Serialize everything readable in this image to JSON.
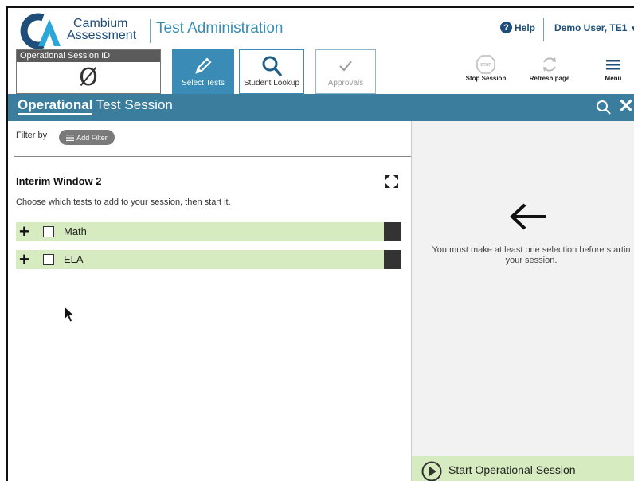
{
  "header": {
    "brand_line1": "Cambium",
    "brand_line2": "Assessment",
    "app_title": "Test Administration",
    "help_label": "Help",
    "user_label": "Demo User, TE1",
    "session_id_label": "Operational Session ID",
    "session_id_value": "Ø"
  },
  "tabs": [
    {
      "label": "Select Tests",
      "icon": "pencil-icon",
      "active": true
    },
    {
      "label": "Student Lookup",
      "icon": "search-icon",
      "active": false
    },
    {
      "label": "Approvals",
      "icon": "checkmark-icon",
      "active": false
    }
  ],
  "tools": [
    {
      "label": "Stop Session",
      "icon": "stop-icon"
    },
    {
      "label": "Refresh page",
      "icon": "refresh-icon"
    },
    {
      "label": "Menu",
      "icon": "hamburger-icon"
    }
  ],
  "bar": {
    "title_strong": "Operational",
    "title_rest": "Test Session"
  },
  "left": {
    "filter_label": "Filter by",
    "add_filter_label": "Add Filter",
    "window_title": "Interim Window 2",
    "window_desc": "Choose which tests to add to your session, then start it.",
    "tests": [
      {
        "name": "Math",
        "checked": false
      },
      {
        "name": "ELA",
        "checked": false
      }
    ]
  },
  "right": {
    "notice": "You must make at least one selection before startin your session.",
    "start_label": "Start Operational Session"
  },
  "colors": {
    "brand_blue": "#3a8bb5",
    "bar_blue": "#3a7d9c",
    "row_green": "#d6ebbf",
    "navy": "#1f4e79"
  }
}
